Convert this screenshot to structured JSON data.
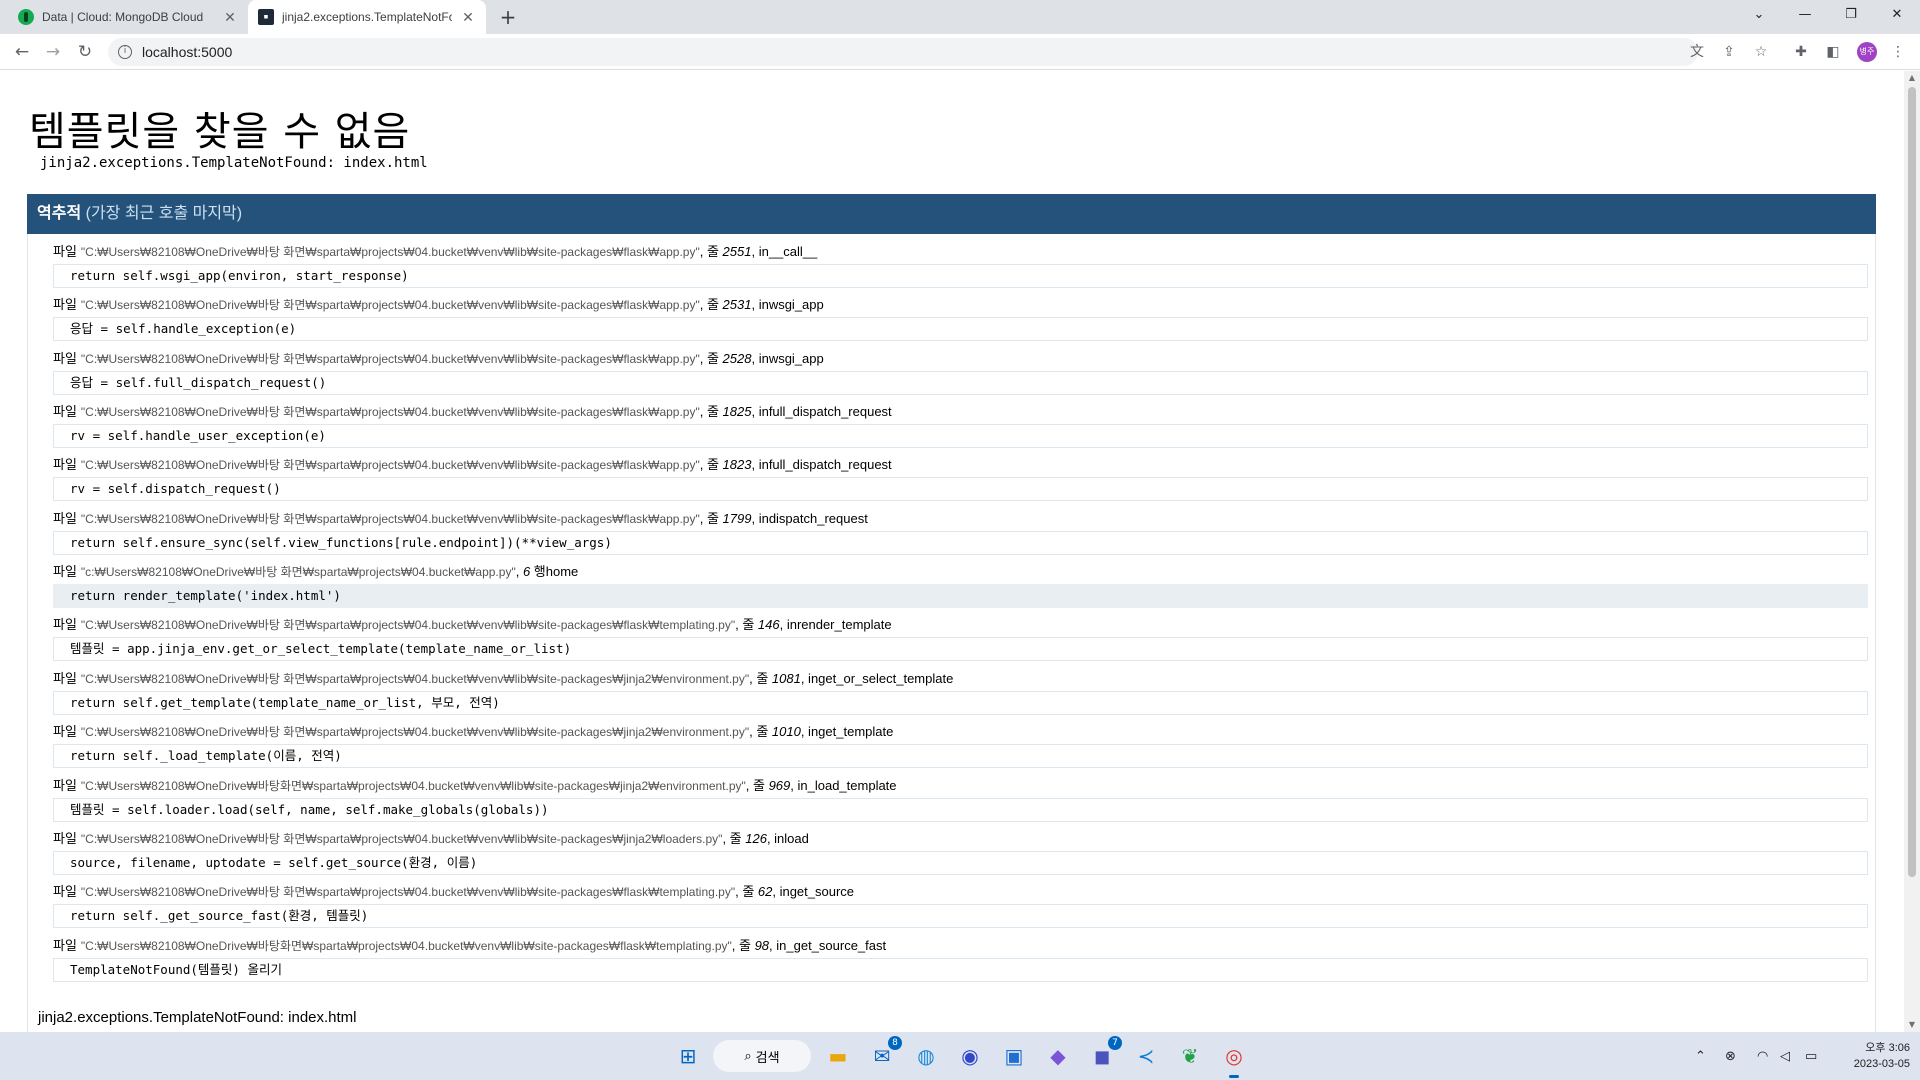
{
  "browser": {
    "tabs": [
      {
        "title": "Data | Cloud: MongoDB Cloud",
        "icon": "mongodb-leaf-icon",
        "active": false
      },
      {
        "title": "jinja2.exceptions.TemplateNotFo",
        "icon": "terminal-icon",
        "active": true
      }
    ],
    "new_tab_symbol": "+",
    "url": "localhost:5000",
    "avatar_text": "병주"
  },
  "page": {
    "title": "템플릿을 찾을 수 없음",
    "error_message": "jinja2.exceptions.TemplateNotFound: index.html",
    "traceback_title": "역추적",
    "traceback_subtitle": "(가장 최근 호출 마지막)",
    "frames": [
      {
        "prefix": "파일",
        "path": "\"C:₩Users₩82108₩OneDrive₩바탕 화면₩sparta₩projects₩04.bucket₩venv₩lib₩site-packages₩flask₩app.py\"",
        "sep1": ", 줄 ",
        "line": "2551",
        "sep2": ", in",
        "func": "__call__",
        "code": "return self.wsgi_app(environ, start_response)",
        "current": false
      },
      {
        "prefix": "파일",
        "path": "\"C:₩Users₩82108₩OneDrive₩바탕 화면₩sparta₩projects₩04.bucket₩venv₩lib₩site-packages₩flask₩app.py\"",
        "sep1": ", 줄 ",
        "line": "2531",
        "sep2": ", in",
        "func": "wsgi_app",
        "code": "응답 = self.handle_exception(e)",
        "current": false
      },
      {
        "prefix": "파일",
        "path": "\"C:₩Users₩82108₩OneDrive₩바탕 화면₩sparta₩projects₩04.bucket₩venv₩lib₩site-packages₩flask₩app.py\"",
        "sep1": ", 줄 ",
        "line": "2528",
        "sep2": ", in",
        "func": "wsgi_app",
        "code": "응답 = self.full_dispatch_request()",
        "current": false
      },
      {
        "prefix": "파일",
        "path": "\"C:₩Users₩82108₩OneDrive₩바탕 화면₩sparta₩projects₩04.bucket₩venv₩lib₩site-packages₩flask₩app.py\"",
        "sep1": ", 줄 ",
        "line": "1825",
        "sep2": ", in",
        "func": "full_dispatch_request",
        "code": "rv = self.handle_user_exception(e)",
        "current": false
      },
      {
        "prefix": "파일",
        "path": "\"C:₩Users₩82108₩OneDrive₩바탕 화면₩sparta₩projects₩04.bucket₩venv₩lib₩site-packages₩flask₩app.py\"",
        "sep1": ", 줄 ",
        "line": "1823",
        "sep2": ", in",
        "func": "full_dispatch_request",
        "code": "rv = self.dispatch_request()",
        "current": false
      },
      {
        "prefix": "파일",
        "path": "\"C:₩Users₩82108₩OneDrive₩바탕 화면₩sparta₩projects₩04.bucket₩venv₩lib₩site-packages₩flask₩app.py\"",
        "sep1": ", 줄 ",
        "line": "1799",
        "sep2": ", in",
        "func": "dispatch_request",
        "code": "return self.ensure_sync(self.view_functions[rule.endpoint])(**view_args)",
        "current": false
      },
      {
        "prefix": "파일",
        "path": "\"c:₩Users₩82108₩OneDrive₩바탕 화면₩sparta₩projects₩04.bucket₩app.py\"",
        "sep1": ", ",
        "line": "6",
        "sep2": " 행",
        "func": "home",
        "code": "return render_template('index.html')",
        "current": true
      },
      {
        "prefix": "파일",
        "path": "\"C:₩Users₩82108₩OneDrive₩바탕 화면₩sparta₩projects₩04.bucket₩venv₩lib₩site-packages₩flask₩templating.py\"",
        "sep1": ", 줄 ",
        "line": "146",
        "sep2": ", in",
        "func": "render_template",
        "code": "템플릿 = app.jinja_env.get_or_select_template(template_name_or_list)",
        "current": false
      },
      {
        "prefix": "파일",
        "path": "\"C:₩Users₩82108₩OneDrive₩바탕 화면₩sparta₩projects₩04.bucket₩venv₩lib₩site-packages₩jinja2₩environment.py\"",
        "sep1": ", 줄 ",
        "line": "1081",
        "sep2": ", in",
        "func": "get_or_select_template",
        "code": "return self.get_template(template_name_or_list, 부모, 전역)",
        "current": false
      },
      {
        "prefix": "파일",
        "path": "\"C:₩Users₩82108₩OneDrive₩바탕 화면₩sparta₩projects₩04.bucket₩venv₩lib₩site-packages₩jinja2₩environment.py\"",
        "sep1": ", 줄 ",
        "line": "1010",
        "sep2": ", in",
        "func": "get_template",
        "code": "return self._load_template(이름, 전역)",
        "current": false
      },
      {
        "prefix": "파일",
        "path": "\"C:₩Users₩82108₩OneDrive₩바탕화면₩sparta₩projects₩04.bucket₩venv₩lib₩site-packages₩jinja2₩environment.py\"",
        "sep1": ", 줄 ",
        "line": "969",
        "sep2": ", in",
        "func": "_load_template",
        "code": "템플릿 = self.loader.load(self, name, self.make_globals(globals))",
        "current": false
      },
      {
        "prefix": "파일",
        "path": "\"C:₩Users₩82108₩OneDrive₩바탕 화면₩sparta₩projects₩04.bucket₩venv₩lib₩site-packages₩jinja2₩loaders.py\"",
        "sep1": ", 줄 ",
        "line": "126",
        "sep2": ", in",
        "func": "load",
        "code": "source, filename, uptodate = self.get_source(환경, 이름)",
        "current": false
      },
      {
        "prefix": "파일",
        "path": "\"C:₩Users₩82108₩OneDrive₩바탕 화면₩sparta₩projects₩04.bucket₩venv₩lib₩site-packages₩flask₩templating.py\"",
        "sep1": ", 줄 ",
        "line": "62",
        "sep2": ", in",
        "func": "get_source",
        "code": "return self._get_source_fast(환경, 템플릿)",
        "current": false
      },
      {
        "prefix": "파일",
        "path": "\"C:₩Users₩82108₩OneDrive₩바탕화면₩sparta₩projects₩04.bucket₩venv₩lib₩site-packages₩flask₩templating.py\"",
        "sep1": ", 줄 ",
        "line": "98",
        "sep2": ", in",
        "func": "_get_source_fast",
        "code": "TemplateNotFound(템플릿) 올리기",
        "current": false
      }
    ],
    "final_message": "jinja2.exceptions.TemplateNotFound: index.html"
  },
  "taskbar": {
    "search_label": "검색",
    "mail_badge": "8",
    "teams_badge": "7",
    "clock_time": "오후 3:06",
    "clock_date": "2023-03-05"
  },
  "colors": {
    "traceback_header_bg": "#24527a",
    "current_frame_bg": "#e9eef2",
    "taskbar_bg": "#dde4ef"
  }
}
